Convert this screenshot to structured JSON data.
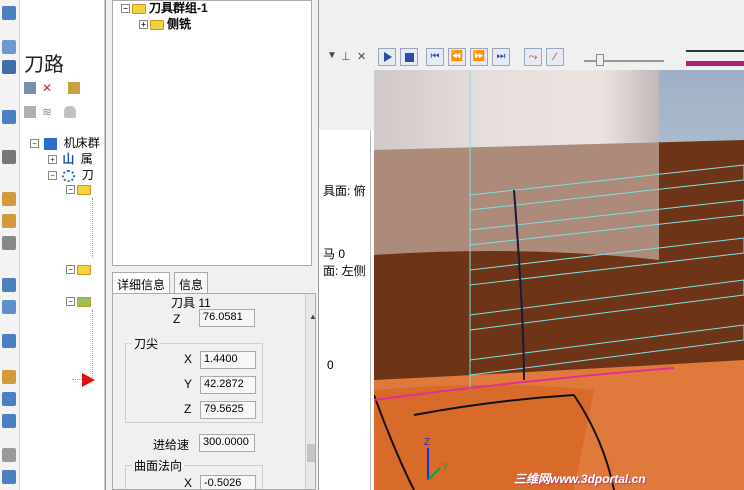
{
  "toolpath_panel": {
    "title": "刀路",
    "tree_items": [
      "机床群",
      "属",
      "刀"
    ]
  },
  "popup": {
    "tree": {
      "root": "刀具群组-1",
      "child": "侧铣"
    },
    "tabs": [
      "详细信息",
      "信息"
    ],
    "details": {
      "tool_label": "刀具 11",
      "z_top": {
        "label": "Z",
        "value": "76.0581"
      },
      "tip_group": "刀尖",
      "tip": [
        {
          "label": "X",
          "value": "1.4400"
        },
        {
          "label": "Y",
          "value": "42.2872"
        },
        {
          "label": "Z",
          "value": "79.5625"
        }
      ],
      "feed_label": "进给速",
      "feed_value": "300.0000",
      "normal_group": "曲面法向",
      "normal_x": {
        "label": "X",
        "value": "-0.5026"
      }
    }
  },
  "center_strip": {
    "lines": [
      "具面: 俯",
      "马 0",
      "面: 左侧",
      "0"
    ]
  },
  "viewport": {
    "watermark": "三维网www.3dportal.cn"
  },
  "colors": {
    "accent_play": "#2a4fa0",
    "slider_bar": "#b0207a",
    "part_brown": "#6e3418",
    "part_orange": "#e07a3c",
    "toolpath_cyan": "#7fe0e0"
  }
}
